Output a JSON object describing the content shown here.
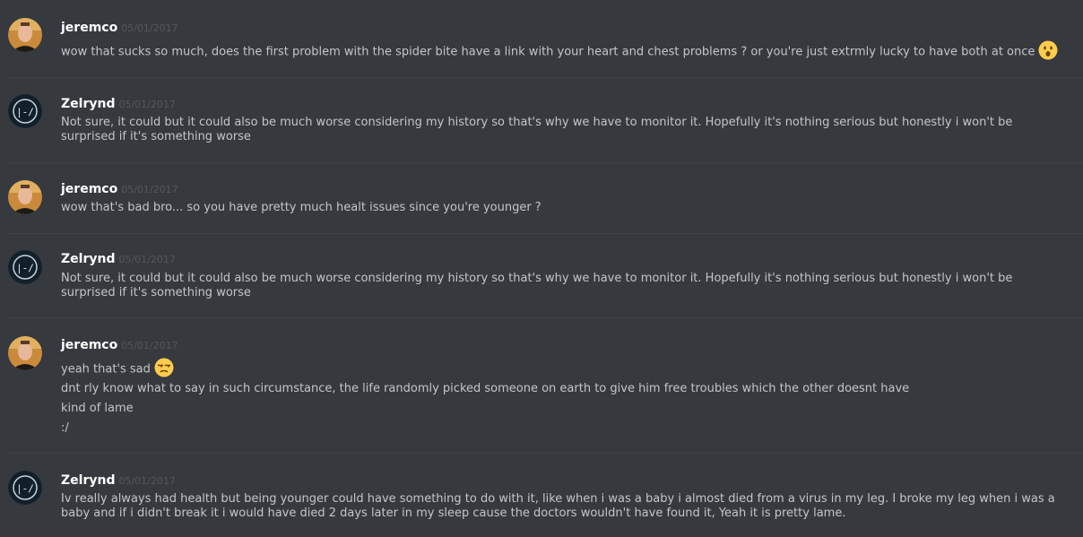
{
  "messages": [
    {
      "author": "jeremco",
      "timestamp": "05/01/2017",
      "avatar": "jeremco-avatar",
      "lines": [
        {
          "text": "wow that sucks so much, does the first problem with the spider bite have a link with your heart and chest problems ? or you're just extrmly lucky to have both at once",
          "emoji": "hushed-face-emoji"
        }
      ]
    },
    {
      "author": "Zelrynd",
      "timestamp": "05/01/2017",
      "avatar": "zelrynd-avatar",
      "lines": [
        {
          "text": "Not sure, it could but it could also be much worse considering my history so that's why we have to monitor it. Hopefully it's nothing serious but honestly i won't be surprised if it's something worse"
        }
      ]
    },
    {
      "author": "jeremco",
      "timestamp": "05/01/2017",
      "avatar": "jeremco-avatar",
      "lines": [
        {
          "text": "wow that's bad bro... so you have pretty much healt issues since you're younger ?"
        }
      ]
    },
    {
      "author": "Zelrynd",
      "timestamp": "05/01/2017",
      "avatar": "zelrynd-avatar",
      "lines": [
        {
          "text": "Not sure, it could but it could also be much worse considering my history so that's why we have to monitor it. Hopefully it's nothing serious but honestly i won't be surprised if it's something worse"
        }
      ]
    },
    {
      "author": "jeremco",
      "timestamp": "05/01/2017",
      "avatar": "jeremco-avatar",
      "lines": [
        {
          "text": "yeah that's sad",
          "emoji": "unamused-face-emoji"
        },
        {
          "text": "dnt rly know what to say in such circumstance, the life randomly picked someone on earth to give him free troubles which the other doesnt have"
        },
        {
          "text": "kind of lame"
        },
        {
          "text": ":/"
        }
      ]
    },
    {
      "author": "Zelrynd",
      "timestamp": "05/01/2017",
      "avatar": "zelrynd-avatar",
      "lines": [
        {
          "text": "Iv really always had health but being younger could have something to do with it, like when i was a baby i almost died from a virus in my leg. I broke my leg when i was a baby and if i didn't break it i would have died 2 days later in my sleep cause the doctors wouldn't have found it, Yeah it is pretty lame."
        }
      ]
    }
  ],
  "colors": {
    "background": "#36393e",
    "divider": "#40444a",
    "username": "#ffffff",
    "timestamp": "#53565b",
    "message_text": "#c4c6c8"
  }
}
